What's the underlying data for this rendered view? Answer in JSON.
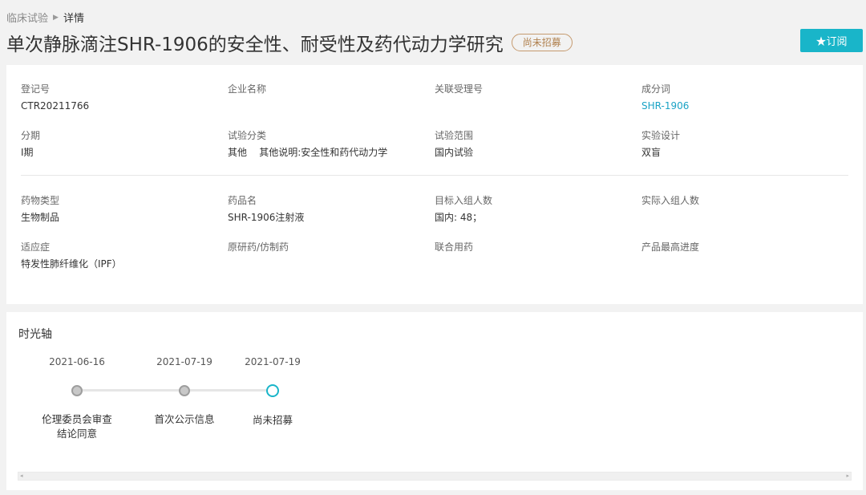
{
  "breadcrumb": {
    "parent": "临床试验",
    "separator": "▶",
    "current": "详情"
  },
  "title": "单次静脉滴注SHR-1906的安全性、耐受性及药代动力学研究",
  "status_badge": "尚未招募",
  "subscribe_button": "★订阅",
  "colors": {
    "accent": "#19b5c9",
    "status_border": "#c59a6e",
    "link": "#1aa3c5"
  },
  "info": {
    "reg_no": {
      "label": "登记号",
      "value": "CTR20211766"
    },
    "company": {
      "label": "企业名称",
      "value": ""
    },
    "related_no": {
      "label": "关联受理号",
      "value": ""
    },
    "ingredient": {
      "label": "成分词",
      "value": "SHR-1906"
    },
    "phase": {
      "label": "分期",
      "value": "I期"
    },
    "category": {
      "label": "试验分类",
      "value": "其他    其他说明:安全性和药代动力学"
    },
    "scope": {
      "label": "试验范围",
      "value": "国内试验"
    },
    "design": {
      "label": "实验设计",
      "value": "双盲"
    },
    "drug_type": {
      "label": "药物类型",
      "value": "生物制品"
    },
    "drug_name": {
      "label": "药品名",
      "value": "SHR-1906注射液"
    },
    "target_enroll": {
      "label": "目标入组人数",
      "value": "国内: 48；"
    },
    "actual_enroll": {
      "label": "实际入组人数",
      "value": ""
    },
    "indication": {
      "label": "适应症",
      "value": "特发性肺纤维化（IPF）"
    },
    "original": {
      "label": "原研药/仿制药",
      "value": ""
    },
    "combination": {
      "label": "联合用药",
      "value": ""
    },
    "max_progress": {
      "label": "产品最高进度",
      "value": ""
    }
  },
  "timeline": {
    "title": "时光轴",
    "events": [
      {
        "date": "2021-06-16",
        "text": "伦理委员会审查\n结论同意"
      },
      {
        "date": "2021-07-19",
        "text": "首次公示信息"
      },
      {
        "date": "2021-07-19",
        "text": "尚未招募"
      }
    ]
  }
}
